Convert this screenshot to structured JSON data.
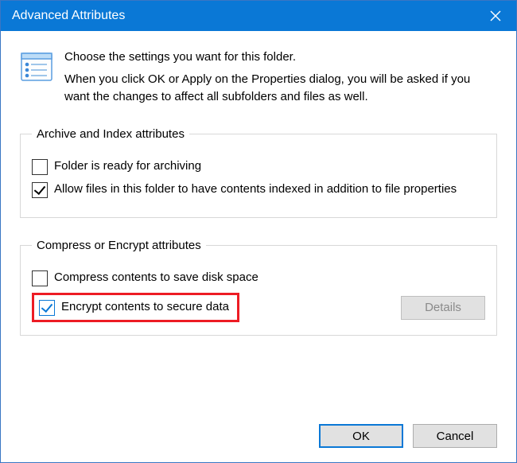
{
  "title": "Advanced Attributes",
  "intro": {
    "line1": "Choose the settings you want for this folder.",
    "line2": "When you click OK or Apply on the Properties dialog, you will be asked if you want the changes to affect all subfolders and files as well."
  },
  "group1": {
    "legend": "Archive and Index attributes",
    "archive": {
      "label": "Folder is ready for archiving",
      "checked": false
    },
    "index": {
      "label": "Allow files in this folder to have contents indexed in addition to file properties",
      "checked": true
    }
  },
  "group2": {
    "legend": "Compress or Encrypt attributes",
    "compress": {
      "label": "Compress contents to save disk space",
      "checked": false
    },
    "encrypt": {
      "label": "Encrypt contents to secure data",
      "checked": true
    },
    "details": "Details"
  },
  "buttons": {
    "ok": "OK",
    "cancel": "Cancel"
  }
}
